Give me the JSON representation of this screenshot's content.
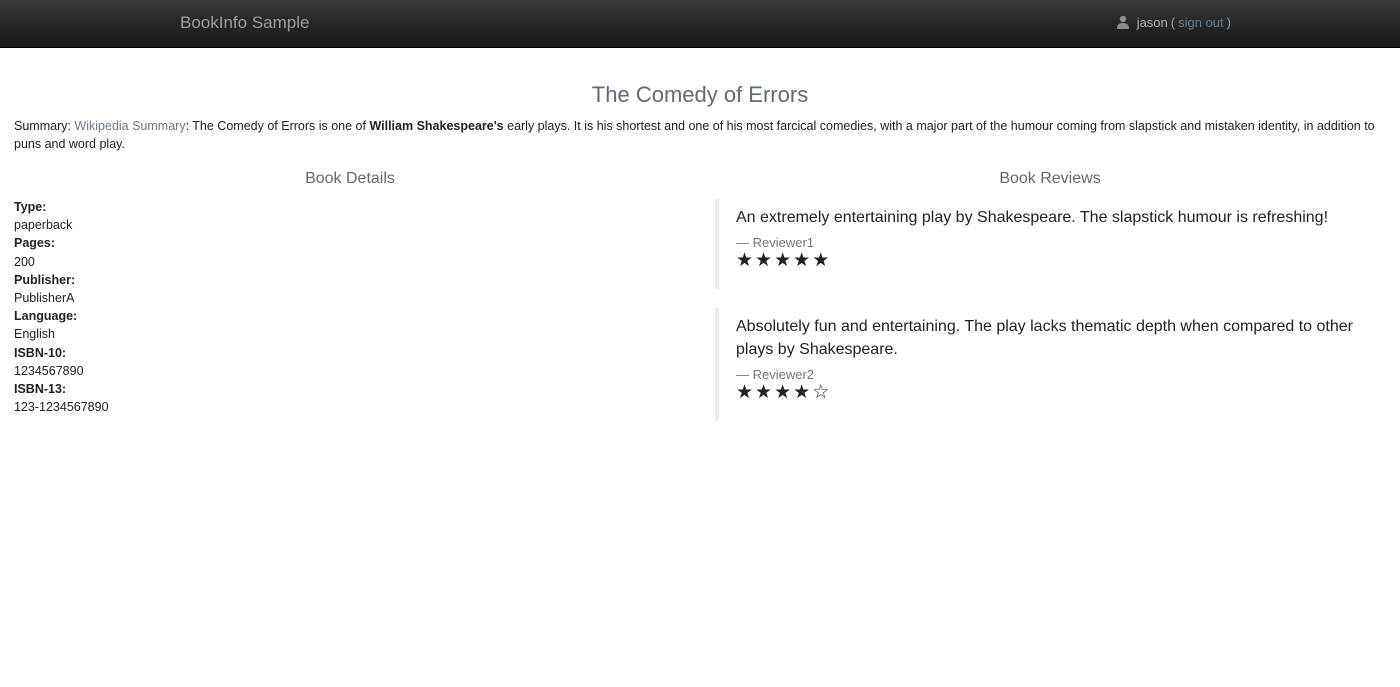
{
  "navbar": {
    "brand": "BookInfo Sample",
    "user_name": "jason",
    "paren_open": "(",
    "sign_out": "sign out",
    "paren_close": ")"
  },
  "book": {
    "title": "The Comedy of Errors",
    "summary_label": "Summary:",
    "summary_link": "Wikipedia Summary",
    "summary_text_1": ": The Comedy of Errors is one of ",
    "summary_bold": "William Shakespeare's",
    "summary_text_2": " early plays. It is his shortest and one of his most farcical comedies, with a major part of the humour coming from slapstick and mistaken identity, in addition to puns and word play."
  },
  "details": {
    "heading": "Book Details",
    "fields": [
      {
        "label": "Type:",
        "value": "paperback"
      },
      {
        "label": "Pages:",
        "value": "200"
      },
      {
        "label": "Publisher:",
        "value": "PublisherA"
      },
      {
        "label": "Language:",
        "value": "English"
      },
      {
        "label": "ISBN-10:",
        "value": "1234567890"
      },
      {
        "label": "ISBN-13:",
        "value": "123-1234567890"
      }
    ]
  },
  "reviews": {
    "heading": "Book Reviews",
    "items": [
      {
        "text": "An extremely entertaining play by Shakespeare. The slapstick humour is refreshing!",
        "reviewer": "— Reviewer1",
        "rating": 5,
        "max_rating": 5
      },
      {
        "text": "Absolutely fun and entertaining. The play lacks thematic depth when compared to other plays by Shakespeare.",
        "reviewer": "— Reviewer2",
        "rating": 4,
        "max_rating": 5
      }
    ]
  },
  "colors": {
    "navbar": "#222222",
    "heading": "#606b76",
    "link": "#6b7b8c",
    "star": "#222222"
  },
  "icons": {
    "user": "user-icon",
    "star_filled": "star-filled-icon",
    "star_empty": "star-empty-icon"
  }
}
